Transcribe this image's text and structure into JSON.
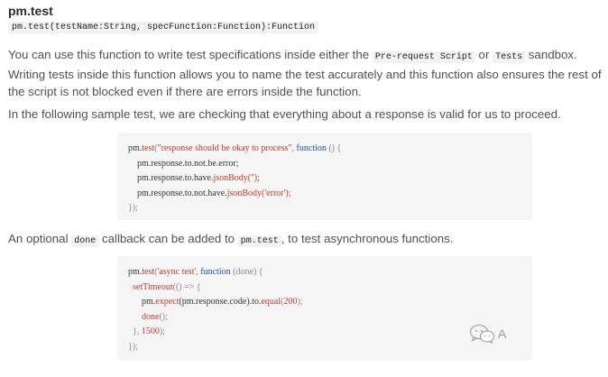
{
  "heading": {
    "title": "pm.test",
    "signature": "pm.test(testName:String, specFunction:Function):Function"
  },
  "para1": {
    "t1": "You can use this function to write test specifications inside either the ",
    "c1": "Pre-request Script",
    "t2": " or ",
    "c2": "Tests",
    "t3": " sandbox. Writing tests inside this function allows you to name the test accurately and this function also ensures the rest of the script is not blocked even if there are errors inside the function."
  },
  "para2": {
    "text": "In the following sample test, we are checking that everything about a response is valid for us to proceed."
  },
  "code1": {
    "l1a": "pm.",
    "l1b": "test",
    "l1c": "(",
    "l1d": "\"response should be okay to process\"",
    "l1e": ", ",
    "l1f": "function",
    "l1g": " () {",
    "l2": "    pm.response.to.not.be.error;",
    "l3a": "    pm.response.to.have.",
    "l3b": "jsonBody",
    "l3c": "('');",
    "l4a": "    pm.response.to.not.have.",
    "l4b": "jsonBody",
    "l4c": "('error');",
    "l5": "});"
  },
  "para3": {
    "t1": "An optional ",
    "c1": "done",
    "t2": " callback can be added to ",
    "c2": "pm.test",
    "t3": ", to test asynchronous functions."
  },
  "code2": {
    "l1a": "pm.",
    "l1b": "test",
    "l1c": "(",
    "l1d": "'async test'",
    "l1e": ", ",
    "l1f": "function",
    "l1g": " (done) {",
    "l2a": "  ",
    "l2b": "setTimeout",
    "l2c": "(() => {",
    "l3a": "      pm.",
    "l3b": "expect",
    "l3c": "(pm.response.code).to.",
    "l3d": "equal",
    "l3e": "(",
    "l3f": "200",
    "l3g": ");",
    "l4a": "      ",
    "l4b": "done",
    "l4c": "();",
    "l5a": "  }, ",
    "l5b": "1500",
    "l5c": ");",
    "l6": "});"
  },
  "watermark": {
    "text": "A",
    "icon": "wechat-icon"
  }
}
